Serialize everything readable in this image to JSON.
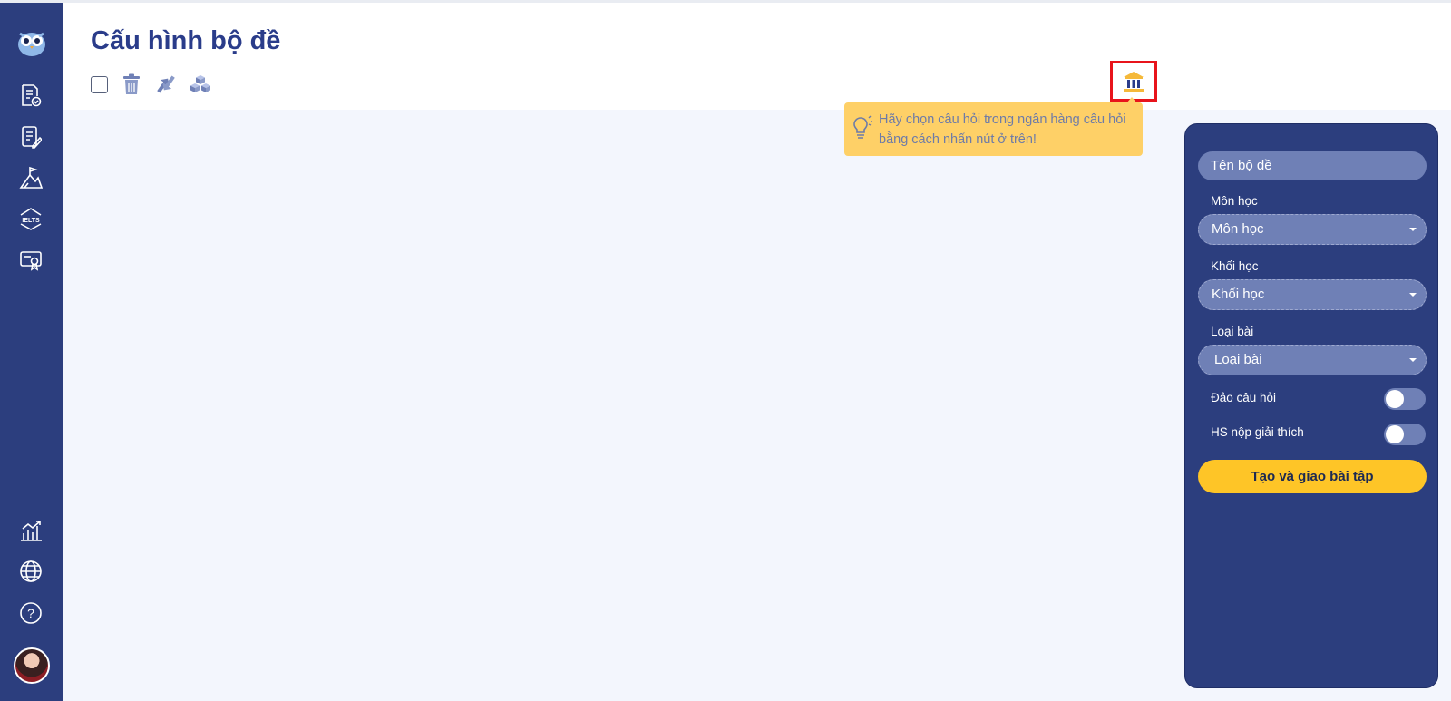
{
  "header": {
    "title": "Cấu hình bộ đề"
  },
  "toolbar": {
    "icons": [
      "checkbox",
      "trash-icon",
      "sort-arrows-icon",
      "cubes-icon"
    ],
    "bank_icon": "bank-icon"
  },
  "hint": {
    "line1": "Hãy chọn câu hỏi trong ngân hàng câu hỏi",
    "line2": "bằng cách nhấn nút ở trên!"
  },
  "sidebar": {
    "items": [
      "owl-logo",
      "document-check-icon",
      "document-edit-icon",
      "mountain-flag-icon",
      "ielts-icon",
      "certificate-icon"
    ],
    "bottom_items": [
      "chart-icon",
      "globe-icon",
      "help-icon",
      "avatar"
    ]
  },
  "panel": {
    "name_placeholder": "Tên bộ đề",
    "subject_label": "Môn học",
    "subject_value": "Môn học",
    "grade_label": "Khối học",
    "grade_value": "Khối học",
    "type_label": "Loại bài",
    "type_value": "Loại bài",
    "shuffle_label": "Đảo câu hỏi",
    "explain_label": "HS nộp giải thích",
    "submit_label": "Tạo và giao bài tập"
  },
  "colors": {
    "sidebar": "#2c3e7e",
    "accent_yellow": "#fec527",
    "hint_bg": "#fed067",
    "title": "#2a3c8a"
  }
}
